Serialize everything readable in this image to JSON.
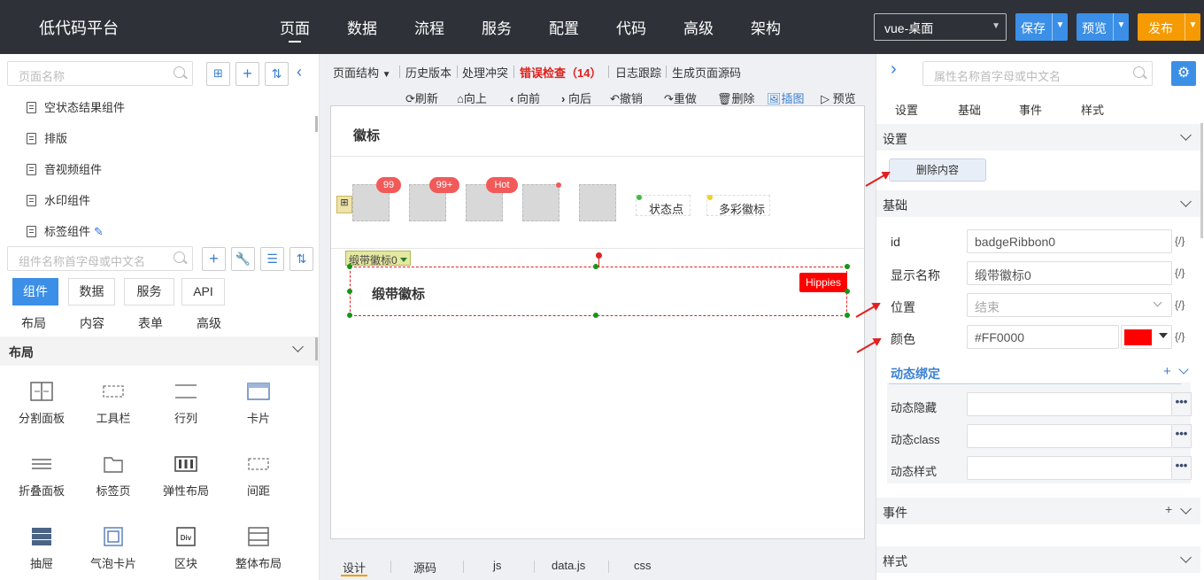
{
  "app": {
    "title": "低代码平台"
  },
  "nav": {
    "items": [
      "页面",
      "数据",
      "流程",
      "服务",
      "配置",
      "代码",
      "高级",
      "架构"
    ],
    "active": "页面"
  },
  "header": {
    "platform_select": "vue-桌面",
    "save_label": "保存",
    "preview_label": "预览",
    "publish_label": "发布",
    "colors": {
      "save": "#3b8fe7",
      "preview": "#3b8fe7",
      "publish": "#f59a00"
    }
  },
  "left": {
    "page_search_placeholder": "页面名称",
    "tree_items": [
      "空状态结果组件",
      "排版",
      "音视频组件",
      "水印组件",
      "标签组件"
    ],
    "comp_search_placeholder": "组件名称首字母或中文名",
    "tabs": [
      "组件",
      "数据",
      "服务",
      "API"
    ],
    "subtabs": [
      "布局",
      "内容",
      "表单",
      "高级"
    ],
    "section_title": "布局",
    "components": [
      {
        "label": "分割面板",
        "icon": "split-panel-icon"
      },
      {
        "label": "工具栏",
        "icon": "toolbar-icon"
      },
      {
        "label": "行列",
        "icon": "row-col-icon"
      },
      {
        "label": "卡片",
        "icon": "card-icon"
      },
      {
        "label": "折叠面板",
        "icon": "collapse-icon"
      },
      {
        "label": "标签页",
        "icon": "tabs-icon"
      },
      {
        "label": "弹性布局",
        "icon": "flex-icon"
      },
      {
        "label": "间距",
        "icon": "spacing-icon"
      },
      {
        "label": "抽屉",
        "icon": "drawer-icon"
      },
      {
        "label": "气泡卡片",
        "icon": "popover-icon"
      },
      {
        "label": "区块",
        "icon": "div-icon"
      },
      {
        "label": "整体布局",
        "icon": "layout-icon"
      }
    ]
  },
  "center": {
    "toolbar": {
      "page_structure": "页面结构",
      "history": "历史版本",
      "conflict": "处理冲突",
      "error_check": "错误检查（14）",
      "log": "日志跟踪",
      "gen_source": "生成页面源码"
    },
    "actions": {
      "refresh": "刷新",
      "up": "向上",
      "forward": "向前",
      "backward": "向后",
      "undo": "撤销",
      "redo": "重做",
      "delete": "删除",
      "insert_image": "插图",
      "preview": "预览"
    },
    "canvas": {
      "badge_title": "徽标",
      "badges": [
        "99",
        "99+",
        "Hot"
      ],
      "status_dot_label": "状态点",
      "colorful_badge_label": "多彩徽标",
      "selected_tag": "缎带徽标0",
      "ribbon_title": "缎带徽标",
      "ribbon_text": "Hippies",
      "ribbon_color": "#FF0000"
    },
    "bottom_tabs": [
      "设计",
      "源码",
      "js",
      "data.js",
      "css"
    ],
    "bottom_active": "设计"
  },
  "right": {
    "search_placeholder": "属性名称首字母或中文名",
    "tabs": [
      "设置",
      "基础",
      "事件",
      "样式"
    ],
    "sections": {
      "settings": "设置",
      "basic": "基础",
      "events": "事件",
      "style": "样式"
    },
    "delete_content": "删除内容",
    "fields": {
      "id_label": "id",
      "id_value": "badgeRibbon0",
      "name_label": "显示名称",
      "name_value": "缎带徽标0",
      "position_label": "位置",
      "position_value": "结束",
      "color_label": "颜色",
      "color_value": "#FF0000"
    },
    "fx": "{/}",
    "dynamic_binding": "动态绑定",
    "dynamic_fields": [
      "动态隐藏",
      "动态class",
      "动态样式"
    ],
    "plus": "+",
    "dots": "•••"
  }
}
